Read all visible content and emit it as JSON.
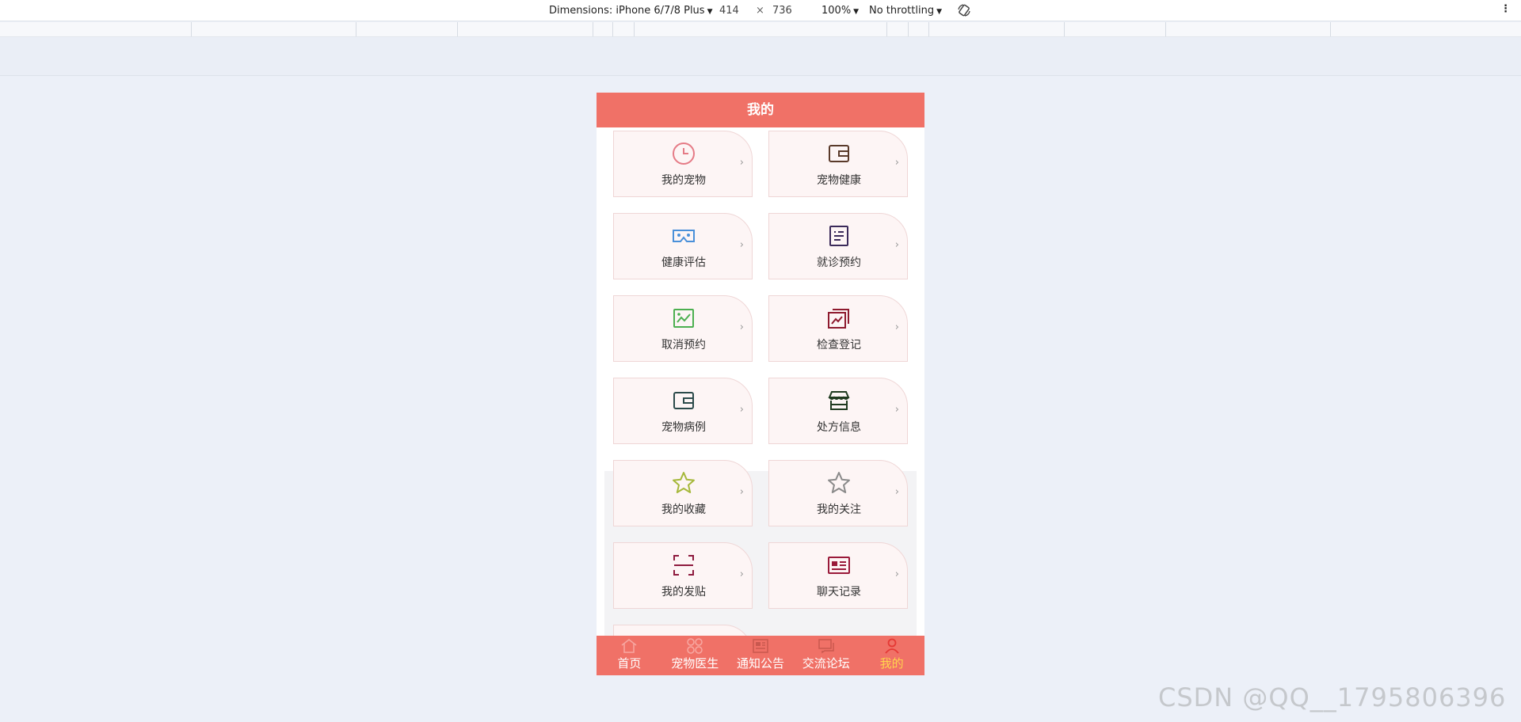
{
  "devtools": {
    "dimensions_label": "Dimensions: iPhone 6/7/8 Plus",
    "width": "414",
    "times": "×",
    "height": "736",
    "zoom": "100%",
    "throttling": "No throttling"
  },
  "header": {
    "title": "我的"
  },
  "menu": [
    {
      "label": "我的宠物",
      "icon": "clock-icon",
      "color": "#e57b86"
    },
    {
      "label": "宠物健康",
      "icon": "wallet-icon",
      "color": "#5a3a2a"
    },
    {
      "label": "健康评估",
      "icon": "vr-glasses-icon",
      "color": "#4a90d9"
    },
    {
      "label": "就诊预约",
      "icon": "document-list-icon",
      "color": "#3b2a5a"
    },
    {
      "label": "取消预约",
      "icon": "chart-image-icon",
      "color": "#4caf50"
    },
    {
      "label": "检查登记",
      "icon": "chart-stack-icon",
      "color": "#8e1a2e"
    },
    {
      "label": "宠物病例",
      "icon": "wallet-icon",
      "color": "#2b4a4a"
    },
    {
      "label": "处方信息",
      "icon": "store-icon",
      "color": "#1f3a1f"
    },
    {
      "label": "我的收藏",
      "icon": "star-icon",
      "color": "#a6b83a"
    },
    {
      "label": "我的关注",
      "icon": "star-icon",
      "color": "#8a8a8a"
    },
    {
      "label": "我的发贴",
      "icon": "scan-icon",
      "color": "#8e1a3e"
    },
    {
      "label": "聊天记录",
      "icon": "id-card-icon",
      "color": "#9a1a3a"
    }
  ],
  "tabbar": [
    {
      "label": "首页",
      "icon": "home-icon"
    },
    {
      "label": "宠物医生",
      "icon": "grid-icon"
    },
    {
      "label": "通知公告",
      "icon": "news-icon"
    },
    {
      "label": "交流论坛",
      "icon": "chat-icon"
    },
    {
      "label": "我的",
      "icon": "user-icon"
    }
  ],
  "watermark": "CSDN @QQ__1795806396"
}
